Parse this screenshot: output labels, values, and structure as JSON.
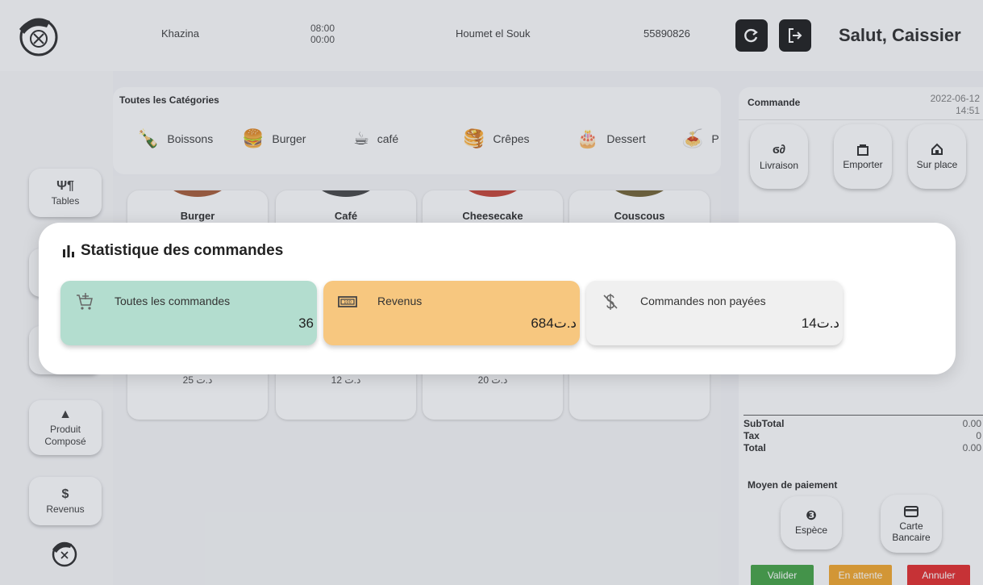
{
  "header": {
    "store_name": "Khazina",
    "hours": {
      "open": "08:00",
      "close": "00:00"
    },
    "location": "Houmet el Souk",
    "phone": "55890826",
    "greeting": "Salut, Caissier",
    "refresh_icon": "refresh-icon",
    "logout_icon": "logout-icon"
  },
  "sidebar": {
    "items": [
      {
        "label": "Tables",
        "icon": "cutlery-icon"
      },
      {
        "label": "Produit Composé",
        "icon": "burger-combo-icon"
      },
      {
        "label": "Revenus",
        "icon": "dollar-icon"
      }
    ]
  },
  "categories": {
    "title": "Toutes les Catégories",
    "items": [
      {
        "label": "Boissons",
        "icon": "bottle-icon"
      },
      {
        "label": "Burger",
        "icon": "burger-icon"
      },
      {
        "label": "café",
        "icon": "coffee-icon"
      },
      {
        "label": "Crêpes",
        "icon": "crepe-icon"
      },
      {
        "label": "Dessert",
        "icon": "cake-icon"
      },
      {
        "label": "P",
        "icon": "pasta-icon"
      }
    ]
  },
  "products": [
    {
      "name": "Burger",
      "price": "د.ت 25"
    },
    {
      "name": "Café",
      "price": "د.ت 12"
    },
    {
      "name": "Cheesecake",
      "price": "د.ت 20"
    },
    {
      "name": "Couscous",
      "price": ""
    }
  ],
  "order": {
    "title": "Commande",
    "date": "2022-06-12",
    "time": "14:51",
    "types": [
      {
        "label": "Livraison",
        "icon": "scooter-icon"
      },
      {
        "label": "Emporter",
        "icon": "bag-icon"
      },
      {
        "label": "Sur place",
        "icon": "home-icon"
      }
    ],
    "subtotal_label": "SubTotal",
    "subtotal_value": "0.00",
    "tax_label": "Tax",
    "tax_value": "0",
    "total_label": "Total",
    "total_value": "0.00",
    "payment_title": "Moyen de paiement",
    "payment_methods": [
      {
        "label": "Espèce",
        "icon": "coin-icon"
      },
      {
        "label": "Carte Bancaire",
        "icon": "credit-card-icon"
      }
    ],
    "actions": {
      "validate": "Valider",
      "pending": "En attente",
      "cancel": "Annuler"
    }
  },
  "stats_modal": {
    "title": "Statistique des commandes",
    "cards": [
      {
        "label": "Toutes les commandes",
        "value": "36",
        "icon": "cart-plus-icon",
        "color": "#b3ddcf"
      },
      {
        "label": "Revenus",
        "value": "684د.ت",
        "icon": "banknote-icon",
        "color": "#f7c77f"
      },
      {
        "label": "Commandes non payées",
        "value": "14د.ت",
        "icon": "dollar-off-icon",
        "color": "#f0f0f0"
      }
    ]
  },
  "colors": {
    "validate": "#3a9d3a",
    "pending": "#f0a020",
    "cancel": "#e02020"
  }
}
